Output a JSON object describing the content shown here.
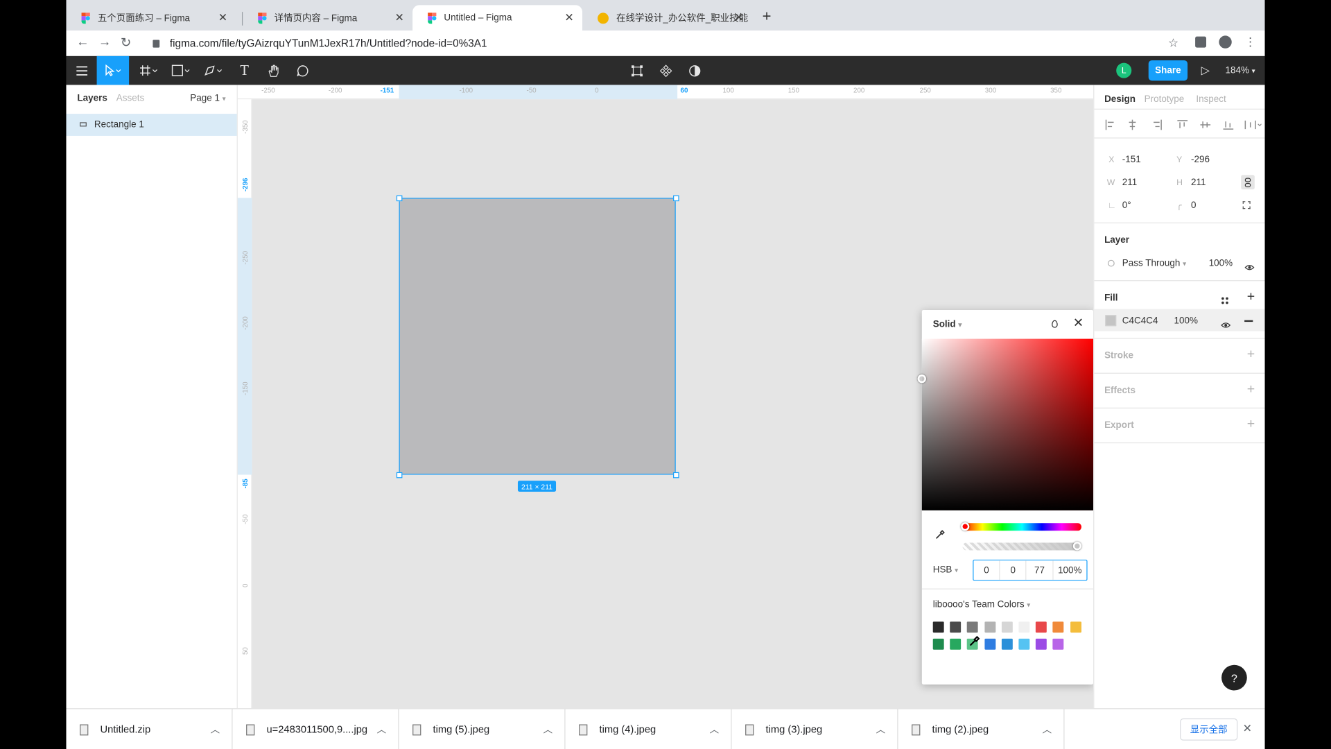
{
  "browser": {
    "tabs": [
      {
        "title": "五个页面练习 – Figma",
        "close": "✕"
      },
      {
        "title": "详情页内容 – Figma",
        "close": "✕"
      },
      {
        "title": "Untitled – Figma",
        "close": "✕"
      },
      {
        "title": "在线学设计_办公软件_职业技能",
        "close": "✕"
      }
    ],
    "new_tab": "+",
    "url": "figma.com/file/tyGAizrquYTunM1JexR17h/Untitled?node-id=0%3A1",
    "back_icon": "←",
    "forward_icon": "→",
    "reload_icon": "↻",
    "lock_icon": "🔒"
  },
  "toolbar": {
    "share": "Share",
    "avatar": "L",
    "zoom": "184%",
    "play_icon": "▷",
    "tools": [
      "menu-icon",
      "move-tool-icon",
      "frame-tool-icon",
      "shape-tool-icon",
      "pen-tool-icon",
      "text-tool-icon",
      "hand-tool-icon",
      "comment-tool-icon"
    ],
    "text_tool_glyph": "T"
  },
  "left_panel": {
    "tabs": [
      "Layers",
      "Assets"
    ],
    "page": "Page 1",
    "layers": [
      {
        "name": "Rectangle 1"
      }
    ]
  },
  "rulers": {
    "top": [
      "-250",
      "-200",
      "-151",
      "-100",
      "-50",
      "0",
      "60",
      "100",
      "150",
      "200",
      "250",
      "300",
      "350"
    ],
    "left": [
      "-350",
      "-296",
      "-250",
      "-200",
      "-150",
      "-85",
      "-50",
      "0",
      "50"
    ]
  },
  "canvas": {
    "rect_color": "#bababc",
    "selection_color": "#18a0fb",
    "size_badge": "211 × 211"
  },
  "color_picker": {
    "mode": "Solid",
    "color_model": "HSB",
    "values": [
      "0",
      "0",
      "77",
      "100%"
    ],
    "library": "liboooo's Team Colors",
    "swatches_row1": [
      "#2a2a2a",
      "#4b4b4b",
      "#7a7a7a",
      "#b3b3b3",
      "#d6d6d6",
      "#f0f0f0",
      "#e8484a",
      "#f08a3a",
      "#f4bd3c"
    ],
    "swatches_row2": [
      "#1e8c4e",
      "#27a85f",
      "#5cc488",
      "#2f7de1",
      "#2b90d9",
      "#55c3f2",
      "#9b4ce5",
      "#b865e8"
    ]
  },
  "right_panel": {
    "tabs": [
      "Design",
      "Prototype",
      "Inspect"
    ],
    "x_label": "X",
    "x": "-151",
    "y_label": "Y",
    "y": "-296",
    "w_label": "W",
    "w": "211",
    "h_label": "H",
    "h": "211",
    "rotation": "0°",
    "radius": "0",
    "layer_title": "Layer",
    "blend": "Pass Through",
    "opacity": "100%",
    "fill_title": "Fill",
    "fill_hex": "C4C4C4",
    "fill_opacity": "100%",
    "fill_color": "#c4c4c4",
    "stroke_title": "Stroke",
    "effects_title": "Effects",
    "export_title": "Export"
  },
  "downloads": {
    "items": [
      "Untitled.zip",
      "u=2483011500,9....jpg",
      "timg (5).jpeg",
      "timg (4).jpeg",
      "timg (3).jpeg",
      "timg (2).jpeg"
    ],
    "show_all": "显示全部",
    "close": "✕"
  },
  "help": "?"
}
